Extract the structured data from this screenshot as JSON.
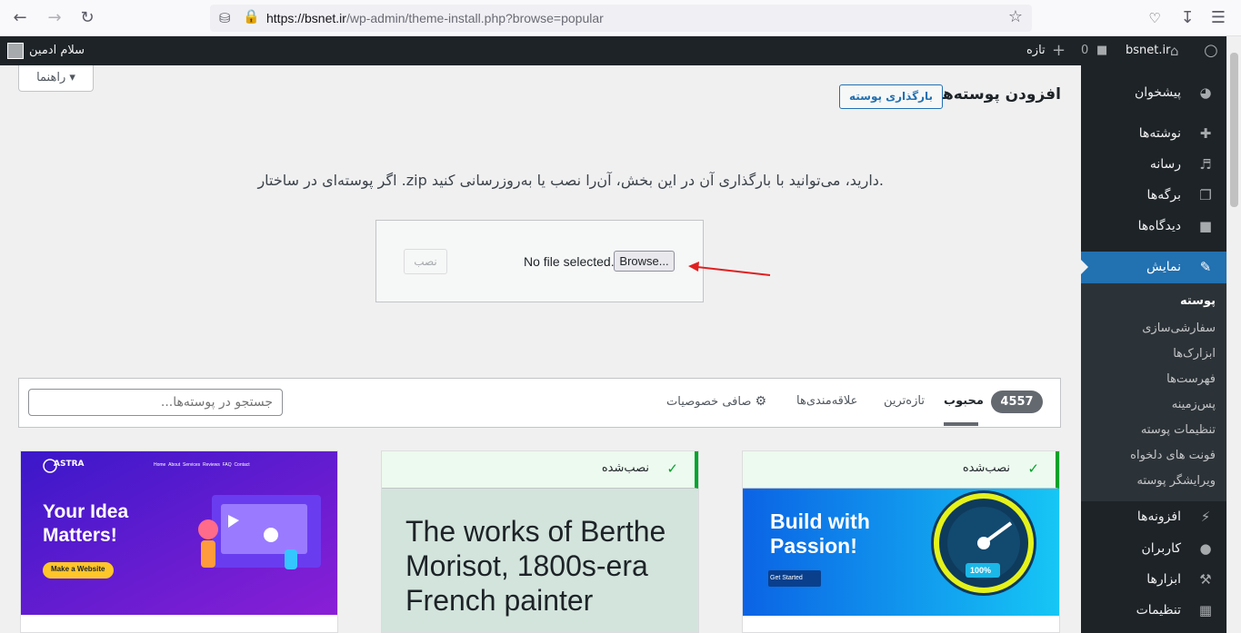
{
  "browser": {
    "url_host": "https://bsnet.ir",
    "url_path": "/wp-admin/theme-install.php?browse=popular"
  },
  "adminbar": {
    "site_name": "bsnet.ir",
    "comments_count": "0",
    "new_label": "تازه",
    "greeting": "سلام ادمین"
  },
  "help_label": "راهنما",
  "page_title": "افزودن پوسته‌ها",
  "upload_button": "بارگذاری پوسته",
  "upload_desc": "اگر پوسته‌ای در ساختار .zip دارید، می‌توانید با بارگذاری آن در این بخش، آن‌را نصب یا به‌روزرسانی کنید.",
  "upload": {
    "browse_label": "Browse...",
    "no_file": "No file selected.",
    "install_label": "نصب"
  },
  "sidebar": {
    "items": [
      {
        "label": "پیشخوان",
        "icon": "dashboard-icon"
      },
      {
        "label": "نوشته‌ها",
        "icon": "pin-icon"
      },
      {
        "label": "رسانه",
        "icon": "media-icon"
      },
      {
        "label": "برگه‌ها",
        "icon": "pages-icon"
      },
      {
        "label": "دیدگاه‌ها",
        "icon": "comments-icon"
      },
      {
        "label": "نمایش",
        "icon": "appearance-icon"
      },
      {
        "label": "افزونه‌ها",
        "icon": "plugins-icon"
      },
      {
        "label": "کاربران",
        "icon": "users-icon"
      },
      {
        "label": "ابزارها",
        "icon": "tools-icon"
      },
      {
        "label": "تنظیمات",
        "icon": "settings-icon"
      }
    ],
    "submenu": [
      "پوسته",
      "سفارشی‌سازی",
      "ابزارک‌ها",
      "فهرست‌ها",
      "پس‌زمینه",
      "تنظیمات پوسته",
      "فونت های دلخواه",
      "ویرایشگر پوسته"
    ]
  },
  "filter": {
    "count": "4557",
    "tabs": [
      "محبوب",
      "تازه‌ترین",
      "علاقه‌مندی‌ها"
    ],
    "feature_filter": "صافی خصوصیات",
    "search_placeholder": "جستجو در پوسته‌ها..."
  },
  "themes": [
    {
      "installed_label": "",
      "brand": "ASTRA",
      "nav": [
        "Home",
        "About",
        "Services",
        "Reviews",
        "FAQ",
        "Contact"
      ],
      "headline_1": "Your Idea",
      "headline_2": "Matters!",
      "cta": "Make a Website"
    },
    {
      "installed_label": "نصب‌شده",
      "line_1": "The works of Berthe",
      "line_2": "Morisot, 1800s-era",
      "line_3": "French painter"
    },
    {
      "installed_label": "نصب‌شده",
      "line_1": "Build with",
      "line_2": "Passion!",
      "cta": "Get Started",
      "gauge": "100%"
    }
  ],
  "colors": {
    "admin_dark": "#1d2327",
    "accent": "#2271b1",
    "installed_green": "#00a32a"
  }
}
